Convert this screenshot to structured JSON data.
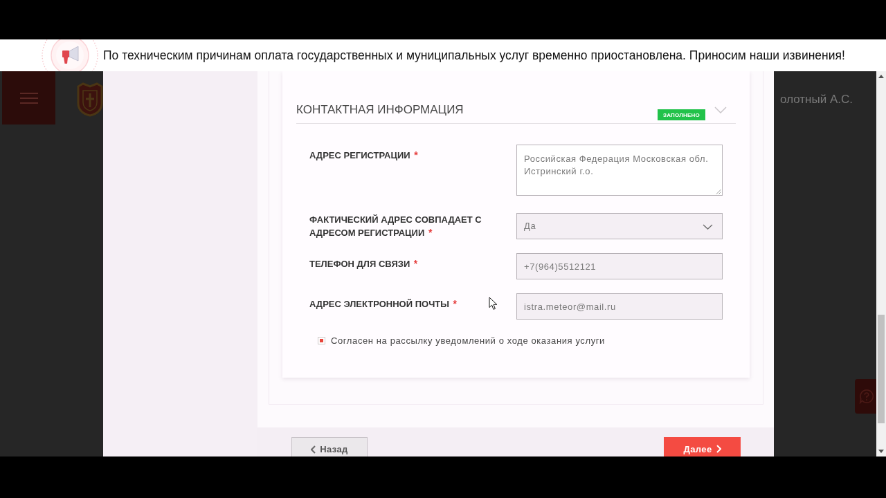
{
  "notice_banner": {
    "text": "По техническим причинам оплата государственных и муниципальных услуг временно приостановлена. Приносим наши извинения!"
  },
  "header": {
    "user_name": "олотный А.С."
  },
  "form_section": {
    "title": "КОНТАКТНАЯ ИНФОРМАЦИЯ",
    "status_badge": "ЗАПОЛНЕНО",
    "fields": [
      {
        "kind": "textarea",
        "label": "АДРЕС РЕГИСТРАЦИИ",
        "required_mark": "*",
        "value": "Российская Федерация Московская обл. Истринский г.о."
      },
      {
        "kind": "select",
        "label": "ФАКТИЧЕСКИЙ АДРЕС СОВПАДАЕТ С АДРЕСОМ РЕГИСТРАЦИИ",
        "required_mark": "*",
        "value": "Да"
      },
      {
        "kind": "input",
        "label": "ТЕЛЕФОН ДЛЯ СВЯЗИ",
        "required_mark": "*",
        "value": "+7(964)5512121"
      },
      {
        "kind": "input",
        "label": "АДРЕС ЭЛЕКТРОННОЙ ПОЧТЫ",
        "required_mark": "*",
        "value": "istra.meteor@mail.ru"
      }
    ],
    "consent": {
      "label": "Согласен на рассылку уведомлений о ходе оказания услуги",
      "checked": true
    }
  },
  "buttons": [
    {
      "kind": "back",
      "label": "Назад"
    },
    {
      "kind": "next",
      "label": "Далее"
    }
  ]
}
